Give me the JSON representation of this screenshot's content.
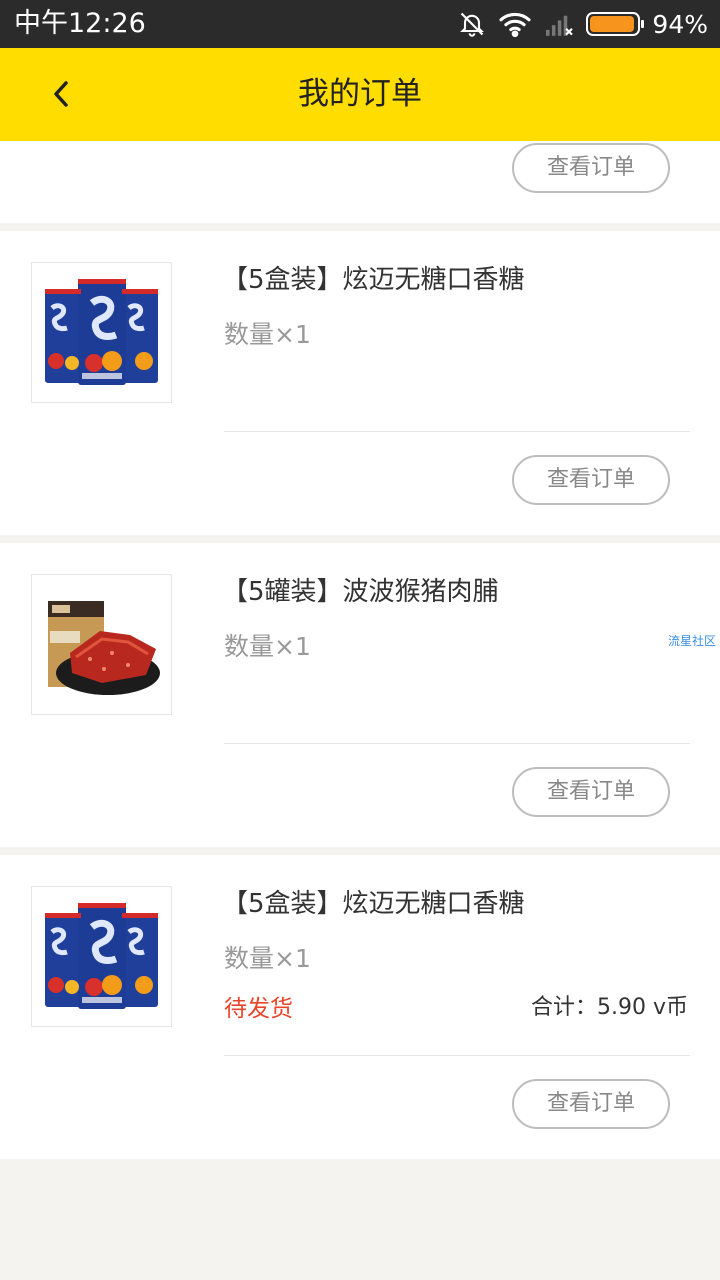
{
  "status_bar": {
    "time": "中午12:26",
    "battery_text": "94%",
    "battery_level": 0.94
  },
  "header": {
    "title": "我的订单"
  },
  "view_order_label": "查看订单",
  "orders": [
    {
      "name": "【5盒装】炫迈无糖口香糖",
      "quantity": "数量×1",
      "image_icon": "gum-pack-image"
    },
    {
      "name": "【5罐装】波波猴猪肉脯",
      "quantity": "数量×1",
      "image_icon": "pork-jerky-image"
    },
    {
      "name": "【5盒装】炫迈无糖口香糖",
      "quantity": "数量×1",
      "status": "待发货",
      "total": "合计：5.90 v币",
      "image_icon": "gum-pack-image"
    }
  ],
  "watermark": "流星社区",
  "colors": {
    "header_bg": "#ffdd00",
    "status_red": "#e8462b",
    "battery": "#f7941d"
  }
}
